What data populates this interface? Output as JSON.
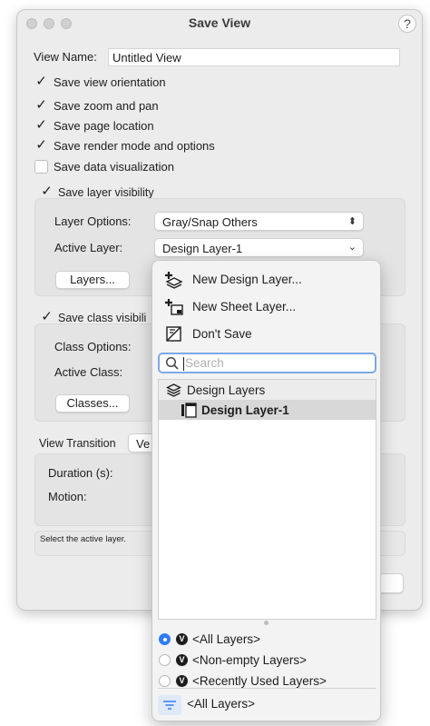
{
  "window": {
    "title": "Save View",
    "help_label": "?"
  },
  "view_name": {
    "label": "View Name:",
    "value": "Untitled View"
  },
  "options": [
    {
      "label": "Save view orientation",
      "checked": true
    },
    {
      "label": "Save zoom and pan",
      "checked": true
    },
    {
      "label": "Save page location",
      "checked": true
    },
    {
      "label": "Save render mode and options",
      "checked": true
    },
    {
      "label": "Save data visualization",
      "checked": false
    }
  ],
  "layer_group": {
    "checkbox_label": "Save layer visibility",
    "layer_options_label": "Layer Options:",
    "layer_options_value": "Gray/Snap Others",
    "active_layer_label": "Active Layer:",
    "active_layer_value": "Design Layer-1",
    "layers_button": "Layers..."
  },
  "class_group": {
    "checkbox_label": "Save class visibili",
    "class_options_label": "Class Options:",
    "active_class_label": "Active Class:",
    "classes_button": "Classes..."
  },
  "transition": {
    "label": "View Transition",
    "value": "Ve",
    "duration_label": "Duration (s):",
    "motion_label": "Motion:"
  },
  "status_text": "Select the active layer.",
  "menu": {
    "new_design_layer": "New Design Layer...",
    "new_sheet_layer": "New Sheet Layer...",
    "dont_save": "Don't Save",
    "search_placeholder": "Search",
    "list_header": "Design Layers",
    "list_item": "Design Layer-1",
    "filters": [
      {
        "label": "<All Layers>",
        "selected": true
      },
      {
        "label": "<Non-empty Layers>",
        "selected": false
      },
      {
        "label": "<Recently Used Layers>",
        "selected": false
      }
    ],
    "footer_filter": "<All Layers>"
  },
  "colors": {
    "accent": "#2f7cf6",
    "focus_ring": "#7ea8e6",
    "window_bg": "#ececec"
  }
}
